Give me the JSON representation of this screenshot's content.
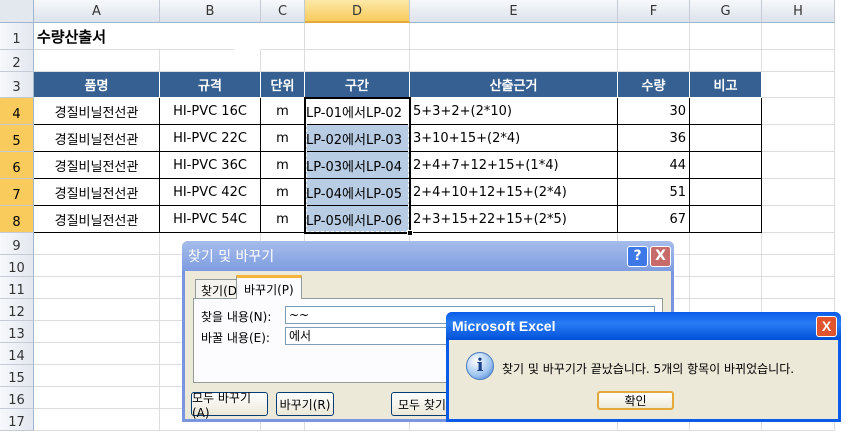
{
  "columns": [
    "A",
    "B",
    "C",
    "D",
    "E",
    "F",
    "G",
    "H"
  ],
  "rows": [
    "1",
    "2",
    "3",
    "4",
    "5",
    "6",
    "7",
    "8",
    "9",
    "10",
    "11",
    "12",
    "13",
    "14",
    "15",
    "16",
    "17"
  ],
  "title": "수량산출서",
  "table": {
    "headers": [
      "품명",
      "규격",
      "단위",
      "구간",
      "산출근거",
      "수량",
      "비고"
    ],
    "rows": [
      [
        "경질비닐전선관",
        "HI-PVC 16C",
        "m",
        "LP-01에서LP-02",
        "5+3+2+(2*10)",
        "30",
        ""
      ],
      [
        "경질비닐전선관",
        "HI-PVC 22C",
        "m",
        "LP-02에서LP-03",
        "3+10+15+(2*4)",
        "36",
        ""
      ],
      [
        "경질비닐전선관",
        "HI-PVC 36C",
        "m",
        "LP-03에서LP-04",
        "2+4+7+12+15+(1*4)",
        "44",
        ""
      ],
      [
        "경질비닐전선관",
        "HI-PVC 42C",
        "m",
        "LP-04에서LP-05",
        "2+4+10+12+15+(2*4)",
        "51",
        ""
      ],
      [
        "경질비닐전선관",
        "HI-PVC 54C",
        "m",
        "LP-05에서LP-06",
        "2+3+15+22+15+(2*5)",
        "67",
        ""
      ]
    ]
  },
  "find_dialog": {
    "title": "찾기 및 바꾸기",
    "help": "?",
    "close": "X",
    "tab_find": "찾기(D)",
    "tab_replace": "바꾸기(P)",
    "find_label": "찾을 내용(N):",
    "find_value": "~~",
    "replace_label": "바꿀 내용(E):",
    "replace_value": "에서",
    "replace_all": "모두 바꾸기(A)",
    "replace": "바꾸기(R)",
    "find_all": "모두 찾기(I)"
  },
  "msgbox": {
    "title": "Microsoft Excel",
    "close": "X",
    "message": "찾기 및 바꾸기가 끝났습니다. 5개의 항목이 바뀌었습니다.",
    "ok": "확인"
  }
}
